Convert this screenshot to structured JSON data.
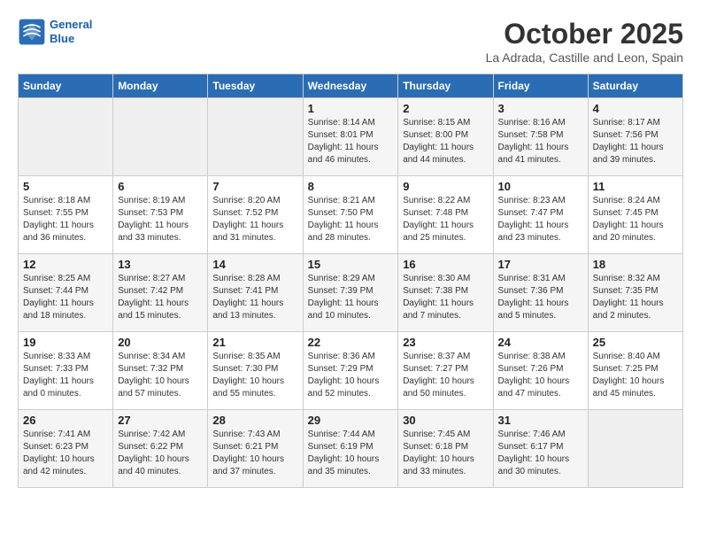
{
  "header": {
    "logo_line1": "General",
    "logo_line2": "Blue",
    "title": "October 2025",
    "subtitle": "La Adrada, Castille and Leon, Spain"
  },
  "days_of_week": [
    "Sunday",
    "Monday",
    "Tuesday",
    "Wednesday",
    "Thursday",
    "Friday",
    "Saturday"
  ],
  "weeks": [
    [
      {
        "day": "",
        "sunrise": "",
        "sunset": "",
        "daylight": ""
      },
      {
        "day": "",
        "sunrise": "",
        "sunset": "",
        "daylight": ""
      },
      {
        "day": "",
        "sunrise": "",
        "sunset": "",
        "daylight": ""
      },
      {
        "day": "1",
        "sunrise": "Sunrise: 8:14 AM",
        "sunset": "Sunset: 8:01 PM",
        "daylight": "Daylight: 11 hours and 46 minutes."
      },
      {
        "day": "2",
        "sunrise": "Sunrise: 8:15 AM",
        "sunset": "Sunset: 8:00 PM",
        "daylight": "Daylight: 11 hours and 44 minutes."
      },
      {
        "day": "3",
        "sunrise": "Sunrise: 8:16 AM",
        "sunset": "Sunset: 7:58 PM",
        "daylight": "Daylight: 11 hours and 41 minutes."
      },
      {
        "day": "4",
        "sunrise": "Sunrise: 8:17 AM",
        "sunset": "Sunset: 7:56 PM",
        "daylight": "Daylight: 11 hours and 39 minutes."
      }
    ],
    [
      {
        "day": "5",
        "sunrise": "Sunrise: 8:18 AM",
        "sunset": "Sunset: 7:55 PM",
        "daylight": "Daylight: 11 hours and 36 minutes."
      },
      {
        "day": "6",
        "sunrise": "Sunrise: 8:19 AM",
        "sunset": "Sunset: 7:53 PM",
        "daylight": "Daylight: 11 hours and 33 minutes."
      },
      {
        "day": "7",
        "sunrise": "Sunrise: 8:20 AM",
        "sunset": "Sunset: 7:52 PM",
        "daylight": "Daylight: 11 hours and 31 minutes."
      },
      {
        "day": "8",
        "sunrise": "Sunrise: 8:21 AM",
        "sunset": "Sunset: 7:50 PM",
        "daylight": "Daylight: 11 hours and 28 minutes."
      },
      {
        "day": "9",
        "sunrise": "Sunrise: 8:22 AM",
        "sunset": "Sunset: 7:48 PM",
        "daylight": "Daylight: 11 hours and 25 minutes."
      },
      {
        "day": "10",
        "sunrise": "Sunrise: 8:23 AM",
        "sunset": "Sunset: 7:47 PM",
        "daylight": "Daylight: 11 hours and 23 minutes."
      },
      {
        "day": "11",
        "sunrise": "Sunrise: 8:24 AM",
        "sunset": "Sunset: 7:45 PM",
        "daylight": "Daylight: 11 hours and 20 minutes."
      }
    ],
    [
      {
        "day": "12",
        "sunrise": "Sunrise: 8:25 AM",
        "sunset": "Sunset: 7:44 PM",
        "daylight": "Daylight: 11 hours and 18 minutes."
      },
      {
        "day": "13",
        "sunrise": "Sunrise: 8:27 AM",
        "sunset": "Sunset: 7:42 PM",
        "daylight": "Daylight: 11 hours and 15 minutes."
      },
      {
        "day": "14",
        "sunrise": "Sunrise: 8:28 AM",
        "sunset": "Sunset: 7:41 PM",
        "daylight": "Daylight: 11 hours and 13 minutes."
      },
      {
        "day": "15",
        "sunrise": "Sunrise: 8:29 AM",
        "sunset": "Sunset: 7:39 PM",
        "daylight": "Daylight: 11 hours and 10 minutes."
      },
      {
        "day": "16",
        "sunrise": "Sunrise: 8:30 AM",
        "sunset": "Sunset: 7:38 PM",
        "daylight": "Daylight: 11 hours and 7 minutes."
      },
      {
        "day": "17",
        "sunrise": "Sunrise: 8:31 AM",
        "sunset": "Sunset: 7:36 PM",
        "daylight": "Daylight: 11 hours and 5 minutes."
      },
      {
        "day": "18",
        "sunrise": "Sunrise: 8:32 AM",
        "sunset": "Sunset: 7:35 PM",
        "daylight": "Daylight: 11 hours and 2 minutes."
      }
    ],
    [
      {
        "day": "19",
        "sunrise": "Sunrise: 8:33 AM",
        "sunset": "Sunset: 7:33 PM",
        "daylight": "Daylight: 11 hours and 0 minutes."
      },
      {
        "day": "20",
        "sunrise": "Sunrise: 8:34 AM",
        "sunset": "Sunset: 7:32 PM",
        "daylight": "Daylight: 10 hours and 57 minutes."
      },
      {
        "day": "21",
        "sunrise": "Sunrise: 8:35 AM",
        "sunset": "Sunset: 7:30 PM",
        "daylight": "Daylight: 10 hours and 55 minutes."
      },
      {
        "day": "22",
        "sunrise": "Sunrise: 8:36 AM",
        "sunset": "Sunset: 7:29 PM",
        "daylight": "Daylight: 10 hours and 52 minutes."
      },
      {
        "day": "23",
        "sunrise": "Sunrise: 8:37 AM",
        "sunset": "Sunset: 7:27 PM",
        "daylight": "Daylight: 10 hours and 50 minutes."
      },
      {
        "day": "24",
        "sunrise": "Sunrise: 8:38 AM",
        "sunset": "Sunset: 7:26 PM",
        "daylight": "Daylight: 10 hours and 47 minutes."
      },
      {
        "day": "25",
        "sunrise": "Sunrise: 8:40 AM",
        "sunset": "Sunset: 7:25 PM",
        "daylight": "Daylight: 10 hours and 45 minutes."
      }
    ],
    [
      {
        "day": "26",
        "sunrise": "Sunrise: 7:41 AM",
        "sunset": "Sunset: 6:23 PM",
        "daylight": "Daylight: 10 hours and 42 minutes."
      },
      {
        "day": "27",
        "sunrise": "Sunrise: 7:42 AM",
        "sunset": "Sunset: 6:22 PM",
        "daylight": "Daylight: 10 hours and 40 minutes."
      },
      {
        "day": "28",
        "sunrise": "Sunrise: 7:43 AM",
        "sunset": "Sunset: 6:21 PM",
        "daylight": "Daylight: 10 hours and 37 minutes."
      },
      {
        "day": "29",
        "sunrise": "Sunrise: 7:44 AM",
        "sunset": "Sunset: 6:19 PM",
        "daylight": "Daylight: 10 hours and 35 minutes."
      },
      {
        "day": "30",
        "sunrise": "Sunrise: 7:45 AM",
        "sunset": "Sunset: 6:18 PM",
        "daylight": "Daylight: 10 hours and 33 minutes."
      },
      {
        "day": "31",
        "sunrise": "Sunrise: 7:46 AM",
        "sunset": "Sunset: 6:17 PM",
        "daylight": "Daylight: 10 hours and 30 minutes."
      },
      {
        "day": "",
        "sunrise": "",
        "sunset": "",
        "daylight": ""
      }
    ]
  ]
}
